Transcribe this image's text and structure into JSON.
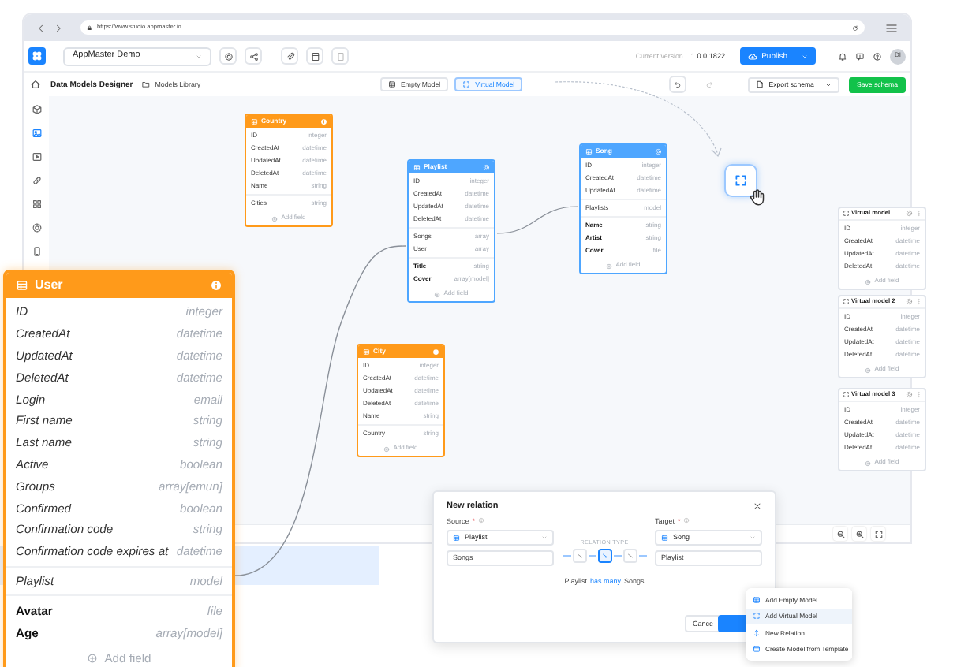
{
  "browser": {
    "url": "https://www.studio.appmaster.io"
  },
  "app": {
    "project": "AppMaster Demo",
    "version_label": "Current version",
    "version": "1.0.0.1822",
    "publish": "Publish",
    "avatar": "DI"
  },
  "toolbar": {
    "title": "Data Models Designer",
    "library": "Models Library",
    "export": "Export schema",
    "save": "Save schema",
    "tabs": [
      {
        "label": "Empty Model",
        "kind": "empty",
        "selected": false
      },
      {
        "label": "Virtual Model",
        "kind": "virtual",
        "selected": true
      }
    ]
  },
  "models": [
    {
      "name": "Country",
      "kind": "model",
      "color": "#ff9a1a",
      "add_field": "Add field",
      "sections": [
        {
          "kind": "system",
          "fields": [
            {
              "name": "ID",
              "type": "integer"
            },
            {
              "name": "CreatedAt",
              "type": "datetime"
            },
            {
              "name": "UpdatedAt",
              "type": "datetime"
            },
            {
              "name": "DeletedAt",
              "type": "datetime"
            },
            {
              "name": "Name",
              "type": "string"
            }
          ]
        },
        {
          "kind": "relation",
          "fields": [
            {
              "name": "Cities",
              "type": "string"
            }
          ]
        }
      ]
    },
    {
      "name": "Playlist",
      "kind": "model",
      "color": "#4ea6ff",
      "add_field": "Add field",
      "sections": [
        {
          "kind": "system",
          "fields": [
            {
              "name": "ID",
              "type": "integer"
            },
            {
              "name": "CreatedAt",
              "type": "datetime"
            },
            {
              "name": "UpdatedAt",
              "type": "datetime"
            },
            {
              "name": "DeletedAt",
              "type": "datetime"
            }
          ]
        },
        {
          "kind": "relation",
          "fields": [
            {
              "name": "Songs",
              "type": "array"
            },
            {
              "name": "User",
              "type": "array"
            }
          ]
        },
        {
          "kind": "custom",
          "fields": [
            {
              "name": "Title",
              "type": "string"
            },
            {
              "name": "Cover",
              "type": "array[model]"
            }
          ]
        }
      ]
    },
    {
      "name": "Song",
      "kind": "model",
      "color": "#4ea6ff",
      "add_field": "Add field",
      "sections": [
        {
          "kind": "system",
          "fields": [
            {
              "name": "ID",
              "type": "integer"
            },
            {
              "name": "CreatedAt",
              "type": "datetime"
            },
            {
              "name": "UpdatedAt",
              "type": "datetime"
            }
          ]
        },
        {
          "kind": "relation",
          "fields": [
            {
              "name": "Playlists",
              "type": "model"
            }
          ]
        },
        {
          "kind": "custom",
          "fields": [
            {
              "name": "Name",
              "type": "string"
            },
            {
              "name": "Artist",
              "type": "string"
            },
            {
              "name": "Cover",
              "type": "file"
            }
          ]
        }
      ]
    },
    {
      "name": "City",
      "kind": "model",
      "color": "#ff9a1a",
      "add_field": "Add field",
      "sections": [
        {
          "kind": "system",
          "fields": [
            {
              "name": "ID",
              "type": "integer"
            },
            {
              "name": "CreatedAt",
              "type": "datetime"
            },
            {
              "name": "UpdatedAt",
              "type": "datetime"
            },
            {
              "name": "DeletedAt",
              "type": "datetime"
            },
            {
              "name": "Name",
              "type": "string"
            }
          ]
        },
        {
          "kind": "relation",
          "fields": [
            {
              "name": "Country",
              "type": "string"
            }
          ]
        }
      ]
    },
    {
      "name": "Virtual model",
      "kind": "virtual",
      "add_field": "Add field",
      "sections": [
        {
          "kind": "system",
          "fields": [
            {
              "name": "ID",
              "type": "integer"
            },
            {
              "name": "CreatedAt",
              "type": "datetime"
            },
            {
              "name": "UpdatedAt",
              "type": "datetime"
            },
            {
              "name": "DeletedAt",
              "type": "datetime"
            }
          ]
        }
      ]
    },
    {
      "name": "Virtual model 2",
      "kind": "virtual",
      "add_field": "Add field",
      "sections": [
        {
          "kind": "system",
          "fields": [
            {
              "name": "ID",
              "type": "integer"
            },
            {
              "name": "CreatedAt",
              "type": "datetime"
            },
            {
              "name": "UpdatedAt",
              "type": "datetime"
            },
            {
              "name": "DeletedAt",
              "type": "datetime"
            }
          ]
        }
      ]
    },
    {
      "name": "Virtual model 3",
      "kind": "virtual",
      "add_field": "Add field",
      "sections": [
        {
          "kind": "system",
          "fields": [
            {
              "name": "ID",
              "type": "integer"
            },
            {
              "name": "CreatedAt",
              "type": "datetime"
            },
            {
              "name": "UpdatedAt",
              "type": "datetime"
            },
            {
              "name": "DeletedAt",
              "type": "datetime"
            }
          ]
        }
      ]
    }
  ],
  "user_card": {
    "name": "User",
    "color": "#ff9a1a",
    "add_field": "Add field",
    "sections": [
      {
        "kind": "system",
        "fields": [
          {
            "name": "ID",
            "type": "integer"
          },
          {
            "name": "CreatedAt",
            "type": "datetime"
          },
          {
            "name": "UpdatedAt",
            "type": "datetime"
          },
          {
            "name": "DeletedAt",
            "type": "datetime"
          },
          {
            "name": "Login",
            "type": "email"
          },
          {
            "name": "First name",
            "type": "string"
          },
          {
            "name": "Last name",
            "type": "string"
          },
          {
            "name": "Active",
            "type": "boolean"
          },
          {
            "name": "Groups",
            "type": "array[emun]"
          },
          {
            "name": "Confirmed",
            "type": "boolean"
          },
          {
            "name": "Confirmation code",
            "type": "string"
          },
          {
            "name": "Confirmation code expires at",
            "type": "datetime"
          }
        ]
      },
      {
        "kind": "relation",
        "fields": [
          {
            "name": "Playlist",
            "type": "model"
          }
        ]
      },
      {
        "kind": "custom",
        "fields": [
          {
            "name": "Avatar",
            "type": "file"
          },
          {
            "name": "Age",
            "type": "array[model]"
          }
        ]
      }
    ]
  },
  "dialog": {
    "title": "New relation",
    "source": {
      "label": "Source",
      "mark": "*",
      "model": "Playlist",
      "field": "Songs"
    },
    "target": {
      "label": "Target",
      "mark": "*",
      "model": "Song",
      "field": "Playlist"
    },
    "relation_type_label": "RELATION TYPE",
    "relation_types": [
      {
        "selected": false
      },
      {
        "selected": true
      },
      {
        "selected": false
      }
    ],
    "summary": [
      {
        "text": "Playlist",
        "kind": "plain"
      },
      {
        "text": "has many",
        "kind": "link"
      },
      {
        "text": "Songs",
        "kind": "plain"
      }
    ],
    "cancel": "Cance"
  },
  "menu": [
    {
      "label": "Add Empty Model",
      "kind": "empty",
      "selected": false
    },
    {
      "label": "Add Virtual Model",
      "kind": "virtual",
      "selected": true
    },
    {
      "label": "New Relation",
      "kind": "relation",
      "selected": false
    },
    {
      "label": "Create Model from Template",
      "kind": "template",
      "selected": false
    }
  ]
}
